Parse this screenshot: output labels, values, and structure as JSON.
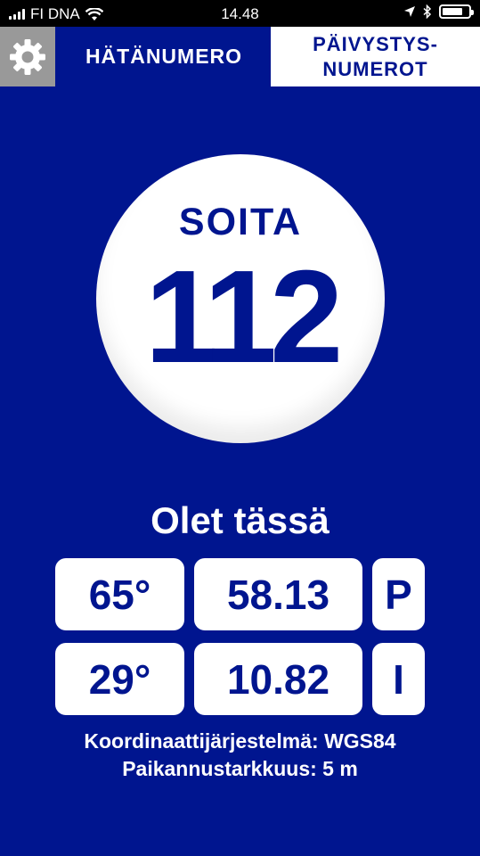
{
  "status_bar": {
    "carrier": "FI DNA",
    "time": "14.48",
    "battery_level": 0.8
  },
  "nav": {
    "settings_icon": "gear-icon",
    "emergency_tab": "HÄTÄNUMERO",
    "oncall_tab_line1": "PÄIVYSTYS-",
    "oncall_tab_line2": "NUMEROT"
  },
  "call_button": {
    "label": "SOITA",
    "number": "112"
  },
  "location": {
    "title": "Olet tässä",
    "lat_degrees": "65°",
    "lat_minutes": "58.13",
    "lat_hemisphere": "P",
    "lon_degrees": "29°",
    "lon_minutes": "10.82",
    "lon_hemisphere": "I",
    "coordinate_system": "Koordinaattijärjestelmä: WGS84",
    "accuracy": "Paikannustarkkuus: 5 m"
  },
  "colors": {
    "background": "#00158f",
    "accent": "#ffffff",
    "settings_bg": "#999999"
  }
}
